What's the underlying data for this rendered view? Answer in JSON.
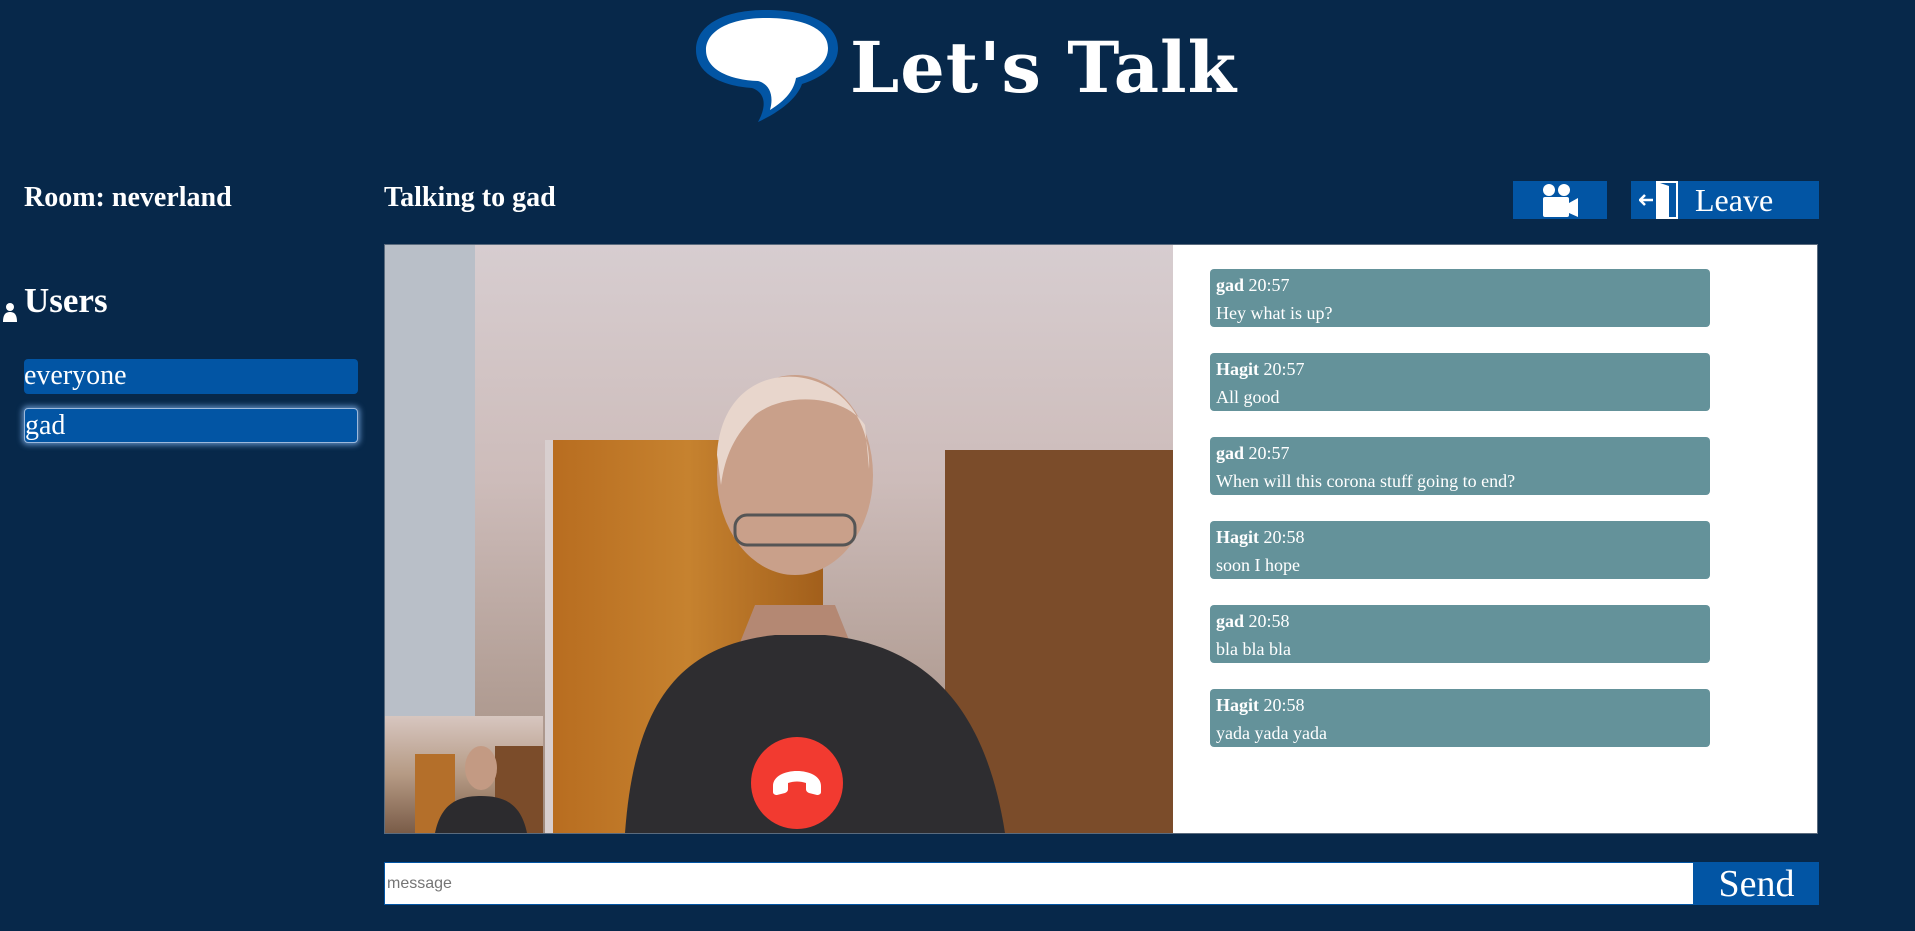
{
  "header": {
    "logo_text": "Let's Talk"
  },
  "sidebar": {
    "room_label": "Room: neverland",
    "users_heading": "Users",
    "users": [
      "everyone",
      "gad"
    ]
  },
  "main": {
    "talking_to": "Talking to gad",
    "leave_label": "Leave"
  },
  "chat": {
    "messages": [
      {
        "sender": "gad",
        "time": "20:57",
        "text": "Hey what is up?"
      },
      {
        "sender": "Hagit",
        "time": "20:57",
        "text": "All good"
      },
      {
        "sender": "gad",
        "time": "20:57",
        "text": "When will this corona stuff going to end?"
      },
      {
        "sender": "Hagit",
        "time": "20:58",
        "text": "soon I hope"
      },
      {
        "sender": "gad",
        "time": "20:58",
        "text": "bla bla bla"
      },
      {
        "sender": "Hagit",
        "time": "20:58",
        "text": "yada yada yada"
      }
    ]
  },
  "composer": {
    "placeholder": "message",
    "send_label": "Send"
  },
  "colors": {
    "background": "#07284a",
    "accent": "#0255a4",
    "message_bubble": "#64929a",
    "hangup": "#f23a30"
  },
  "icons": {
    "logo": "speech-bubble-icon",
    "users": "person-icon",
    "video": "video-camera-icon",
    "leave": "exit-door-icon",
    "hangup": "phone-hangup-icon"
  }
}
